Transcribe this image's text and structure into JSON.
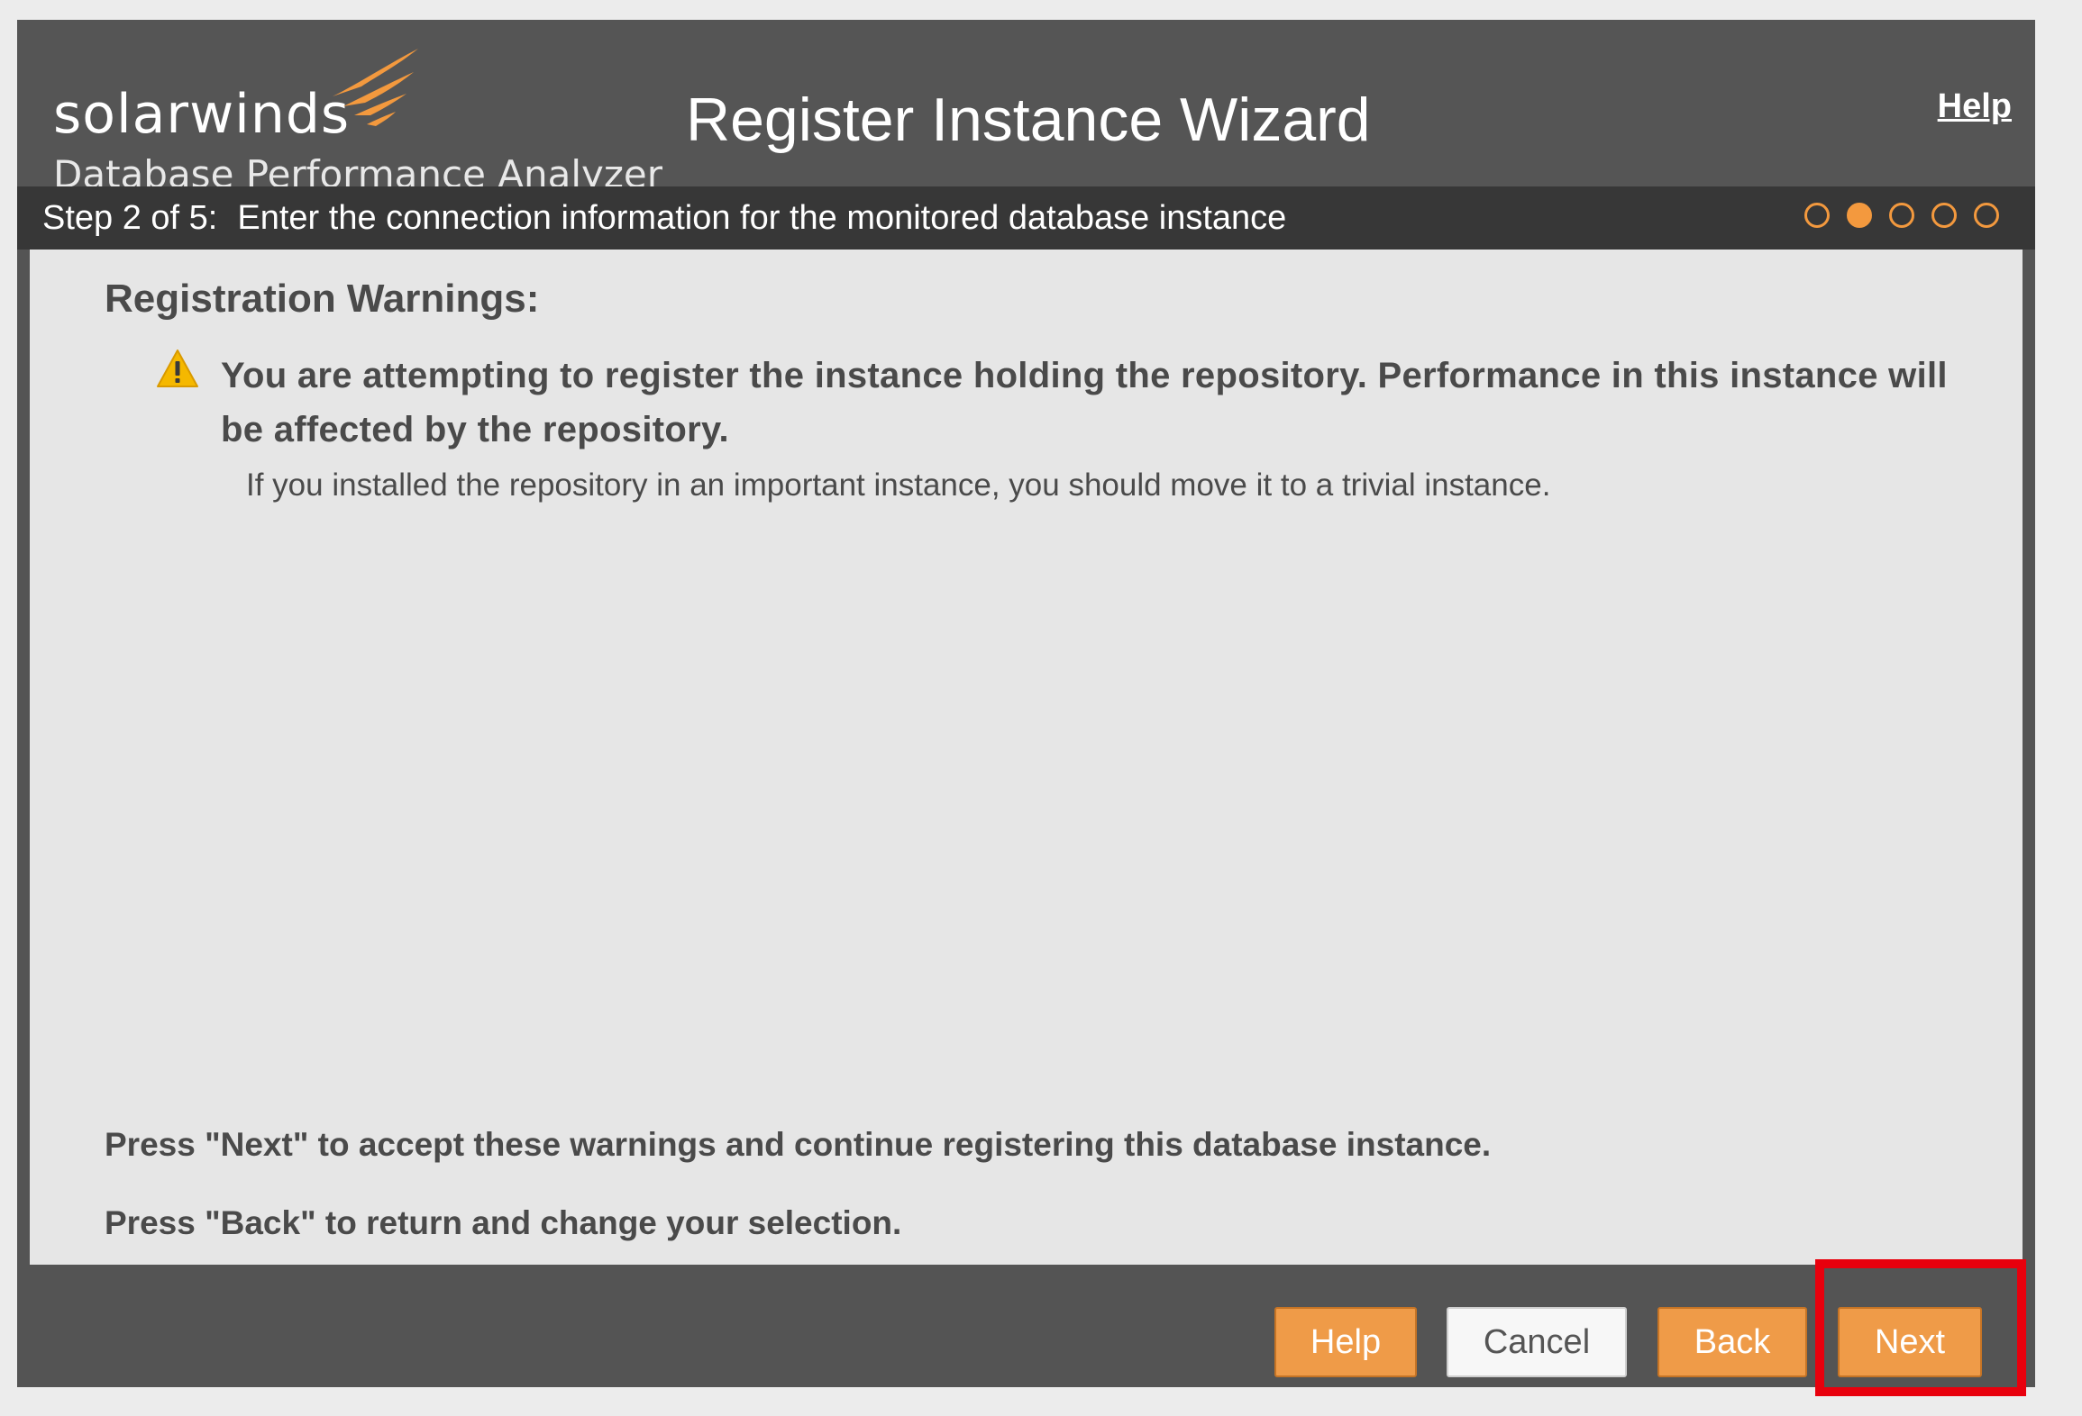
{
  "header": {
    "brand_name": "solarwinds",
    "product_name": "Database Performance Analyzer",
    "title": "Register Instance Wizard",
    "help_link": "Help"
  },
  "stepbar": {
    "step_label": "Step 2 of 5:",
    "step_description": "Enter the connection information for the monitored database instance",
    "total_steps": 5,
    "current_step": 2
  },
  "content": {
    "heading": "Registration Warnings:",
    "warning_message": "You are attempting to register the instance holding the repository. Performance in this instance will be affected by the repository.",
    "warning_detail": "If you installed the repository in an important instance, you should move it to a trivial instance.",
    "instruction_next": "Press \"Next\" to accept these warnings and continue registering this database instance.",
    "instruction_back": "Press \"Back\" to return and change your selection."
  },
  "footer": {
    "help_label": "Help",
    "cancel_label": "Cancel",
    "back_label": "Back",
    "next_label": "Next"
  },
  "colors": {
    "accent_orange": "#ef9b48",
    "header_bg": "#555555",
    "stepbar_bg": "#373737",
    "content_bg": "#e6e6e6",
    "highlight_red": "#e8000d",
    "warning_yellow": "#f5b800"
  },
  "icons": {
    "warning": "warning-triangle-icon",
    "brand": "solarwinds-flame-icon"
  }
}
